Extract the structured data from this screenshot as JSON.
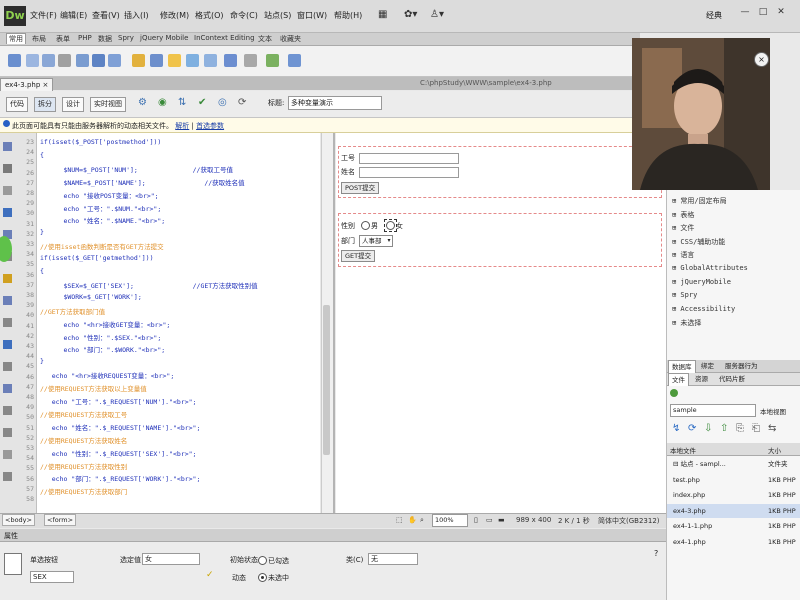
{
  "app": {
    "logo": "Dw",
    "workspace": "经典",
    "window_controls": [
      "—",
      "□",
      "✕"
    ]
  },
  "menu": [
    "文件(F)",
    "编辑(E)",
    "查看(V)",
    "插入(I)",
    "修改(M)",
    "格式(O)",
    "命令(C)",
    "站点(S)",
    "窗口(W)",
    "帮助(H)"
  ],
  "menu_toolbar_glyphs": [
    "▦",
    "✿▾",
    "♙▾"
  ],
  "insert_tabs": [
    "常用",
    "布局",
    "表单",
    "PHP",
    "数据",
    "Spry",
    "jQuery Mobile",
    "InContext Editing",
    "文本",
    "收藏夹"
  ],
  "document": {
    "tab": "ex4-3.php ×",
    "path": "C:\\phpStudy\\WWW\\sample\\ex4-3.php",
    "view_buttons": [
      "代码",
      "拆分",
      "设计",
      "实时视图"
    ],
    "title_label": "标题:",
    "title_value": "多种变量演示"
  },
  "infobar": {
    "text": "此页面可能具有只能由服务器解析的动态相关文件。",
    "links": [
      "解析",
      "|",
      "首选参数"
    ]
  },
  "line_numbers": [
    "23",
    "24",
    "25",
    "26",
    "27",
    "28",
    "29",
    "30",
    "31",
    "32",
    "33",
    "34",
    "35",
    "36",
    "37",
    "38",
    "39",
    "40",
    "41",
    "42",
    "43",
    "44",
    "45",
    "46",
    "47",
    "48",
    "49",
    "50",
    "51",
    "52",
    "53",
    "54",
    "55",
    "56",
    "57",
    "58"
  ],
  "code_lines": [
    {
      "text": "if(isset($_POST['postmethod'])) ",
      "color": "blue"
    },
    {
      "text": "{",
      "color": "blue"
    },
    {
      "text": "      $NUM=$_POST['NUM'];              //获取工号值",
      "color": "blue"
    },
    {
      "text": "      $NAME=$_POST['NAME'];               //获取姓名值",
      "color": "blue"
    },
    {
      "text": "      echo \"接收POST变量：<br>\";",
      "color": "blue"
    },
    {
      "text": "      echo \"工号：\".$NUM.\"<br>\";",
      "color": "blue"
    },
    {
      "text": "      echo \"姓名：\".$NAME.\"<br>\";",
      "color": "blue"
    },
    {
      "text": "}",
      "color": "blue"
    },
    {
      "text": "//使用isset函数判断是否有GET方法提交",
      "color": "orange"
    },
    {
      "text": "if(isset($_GET['getmethod']))",
      "color": "blue"
    },
    {
      "text": "{",
      "color": "blue"
    },
    {
      "text": "      $SEX=$_GET['SEX'];               //GET方法获取性别值",
      "color": "blue"
    },
    {
      "text": "      $WORK=$_GET['WORK'];",
      "color": "blue"
    },
    {
      "text": "//GET方法获取部门值",
      "color": "orange"
    },
    {
      "text": "      echo \"<hr>接收GET变量：<br>\";",
      "color": "blue"
    },
    {
      "text": "      echo \"性别：\".$SEX.\"<br>\";",
      "color": "blue"
    },
    {
      "text": "      echo \"部门：\".$WORK.\"<br>\";",
      "color": "blue"
    },
    {
      "text": "}",
      "color": "blue"
    },
    {
      "text": "   echo \"<hr>接收REQUEST变量：<br>\";",
      "color": "blue"
    },
    {
      "text": "//使用REQUEST方法获取以上变量值",
      "color": "orange"
    },
    {
      "text": "   echo \"工号：\".$_REQUEST['NUM'].\"<br>\";",
      "color": "blue"
    },
    {
      "text": "//使用REQUEST方法获取工号",
      "color": "orange"
    },
    {
      "text": "   echo \"姓名：\".$_REQUEST['NAME'].\"<br>\";",
      "color": "blue"
    },
    {
      "text": "//使用REQUEST方法获取姓名",
      "color": "orange"
    },
    {
      "text": "   echo \"性别：\".$_REQUEST['SEX'].\"<br>\";",
      "color": "blue"
    },
    {
      "text": "//使用REQUEST方法获取性别",
      "color": "orange"
    },
    {
      "text": "   echo \"部门：\".$_REQUEST['WORK'].\"<br>\";",
      "color": "blue"
    },
    {
      "text": "//使用REQUEST方法获取部门",
      "color": "orange"
    }
  ],
  "design": {
    "num_label": "工号",
    "name_label": "姓名",
    "post_button": "POST提交",
    "sex_label": "性别",
    "sex_male": "男",
    "sex_female": "女",
    "dept_label": "部门",
    "dept_value": "人事部",
    "get_button": "GET提交"
  },
  "statusbar": {
    "tag1": "<body>",
    "tag2": "<form>",
    "zoom": "100%",
    "dims": "989 x 400",
    "size": "2 K / 1 秒",
    "encoding": "简体中文(GB2312)"
  },
  "properties": {
    "header": "属性",
    "field_name_label": "单选按钮",
    "field_name_value": "SEX",
    "checked_value_label": "选定值",
    "checked_value": "女",
    "initial_state_label": "初始状态",
    "state_checked": "已勾选",
    "state_unchecked": "未选中",
    "dynamic_label": "动态",
    "class_label": "类(C)",
    "class_value": "无",
    "help": "?"
  },
  "panels": {
    "insert_tree": [
      "⊞ 常用/固定布局",
      "⊞ 表格",
      "⊞ 文件",
      "⊞ CSS/辅助功能",
      "⊞ 语言",
      "⊞ GlobalAttributes",
      "⊞ jQueryMobile",
      "⊞ Spry",
      "⊞ Accessibility",
      "⊞ 未选择"
    ],
    "tabs1": [
      "数据库",
      "绑定",
      "服务器行为"
    ],
    "tabs2": [
      "文件",
      "资源",
      "代码片断"
    ],
    "site": "sample",
    "site_view": "本地视图",
    "files_head_name": "本地文件",
    "files_head_size": "大小",
    "files": [
      {
        "name": "⊟ 站点 - sampl...",
        "size": "文件夹"
      },
      {
        "name": "    test.php",
        "size": "1KB PHP"
      },
      {
        "name": "    index.php",
        "size": "1KB PHP"
      },
      {
        "name": "    ex4-3.php",
        "size": "1KB PHP"
      },
      {
        "name": "    ex4-1-1.php",
        "size": "1KB PHP"
      },
      {
        "name": "    ex4-1.php",
        "size": "1KB PHP"
      }
    ]
  }
}
